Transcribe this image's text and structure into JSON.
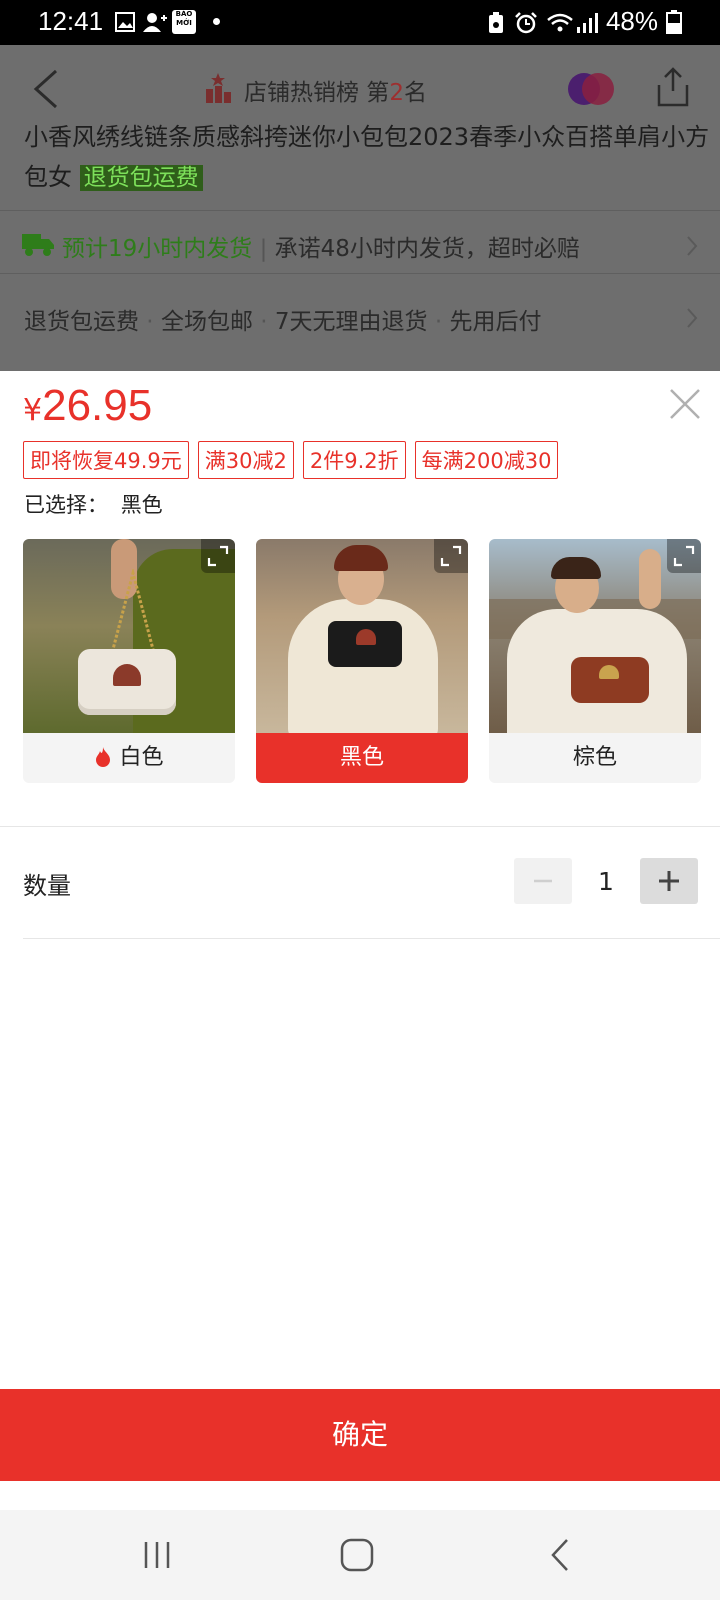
{
  "status_bar": {
    "time": "12:41",
    "battery_percent": "48%",
    "icons": [
      "image-icon",
      "add-person-icon",
      "baomoi-icon",
      "dot-icon",
      "recycle-icon",
      "alarm-icon",
      "wifi-icon",
      "signal-icon",
      "battery-icon"
    ],
    "baomoi_text": "BÁO MỚI"
  },
  "background_page": {
    "rank_prefix": "店铺热销榜 第",
    "rank_number": "2",
    "rank_suffix": "名",
    "product_title": "小香风绣线链条质感斜挎迷你小包包2023春季小众百搭单肩小方包女",
    "return_tag": "退货包运费",
    "shipping_estimate": "预计19小时内发货",
    "shipping_promise": "承诺48小时内发货，超时必赔",
    "perks": [
      "退货包运费",
      "全场包邮",
      "7天无理由退货",
      "先用后付"
    ]
  },
  "sheet": {
    "currency": "¥",
    "price": "26.95",
    "coupons": [
      "即将恢复49.9元",
      "满30减2",
      "2件9.2折",
      "每满200减30"
    ],
    "selected_label": "已选择：",
    "selected_value": "黑色",
    "variants": [
      {
        "label": "白色",
        "hot": true
      },
      {
        "label": "黑色",
        "hot": false
      },
      {
        "label": "棕色",
        "hot": false
      }
    ],
    "quantity_label": "数量",
    "quantity_value": "1",
    "confirm_label": "确定"
  },
  "colors": {
    "accent": "#e8312a",
    "overlay_gray": "#6e6e6e",
    "green": "#2e7d1a"
  }
}
